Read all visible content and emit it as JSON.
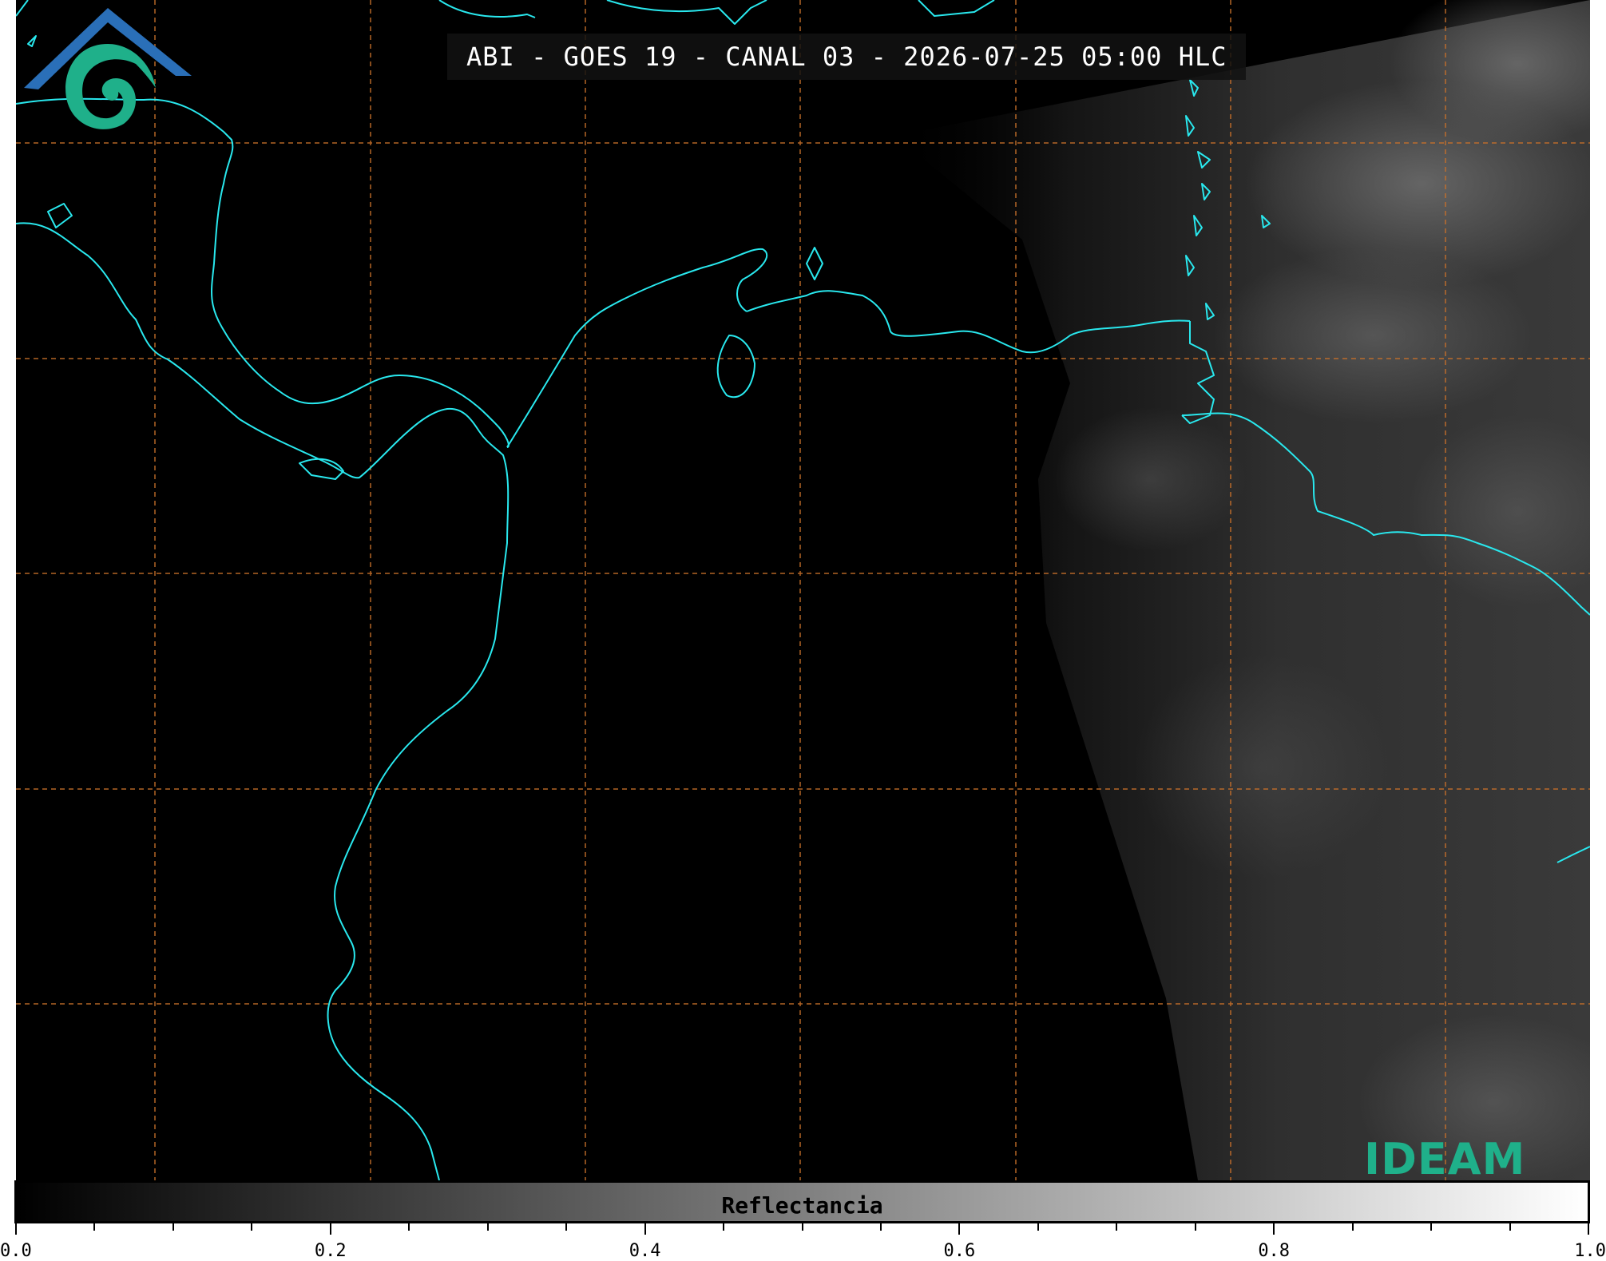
{
  "title": "ABI - GOES 19 - CANAL 03 - 2026-07-25 05:00 HLC",
  "logo": {
    "text": "IDEAM",
    "colors": {
      "roof": "#2a6fb8",
      "swirl": "#1fb08a"
    }
  },
  "colorbar": {
    "label": "Reflectancia",
    "min": 0.0,
    "max": 1.0,
    "colormap": "grayscale (black to white)",
    "major_ticks": [
      "0.0",
      "0.2",
      "0.4",
      "0.6",
      "0.8",
      "1.0"
    ],
    "minor_tick_step": 0.05
  },
  "map": {
    "background_color": "#000000",
    "coastline_color": "#29e8ee",
    "graticule_color": "#c8702a",
    "graticule_style": "dashed"
  }
}
